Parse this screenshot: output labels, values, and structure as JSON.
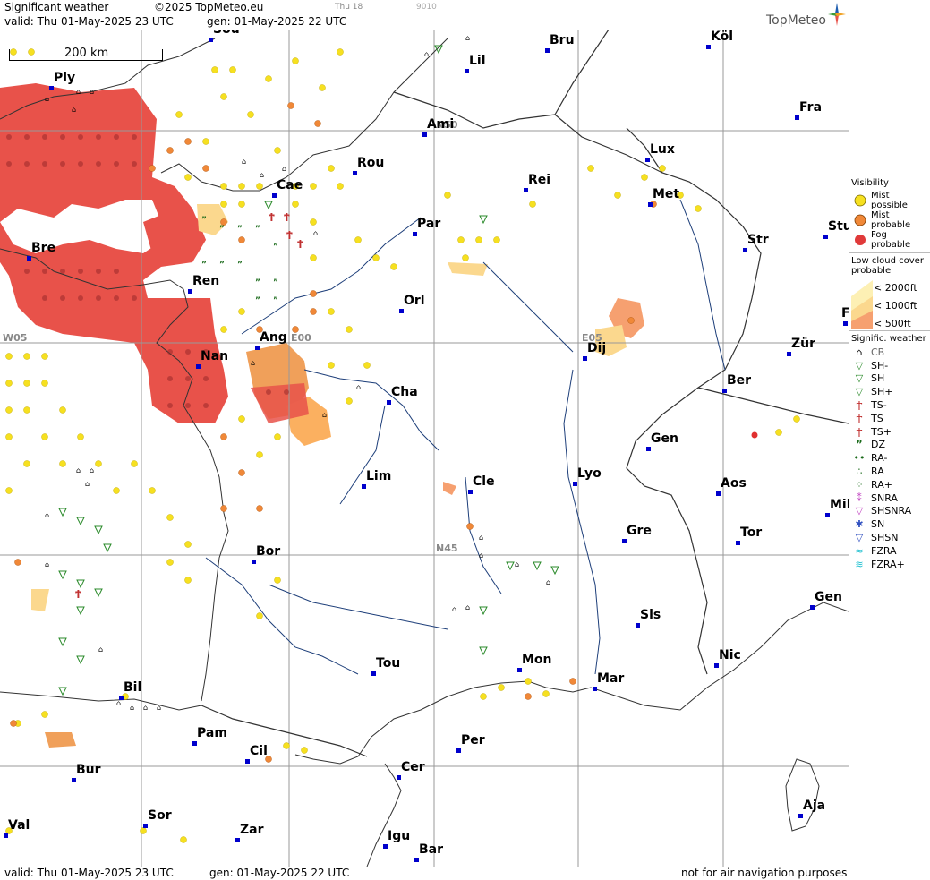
{
  "header": {
    "title": "Significant weather",
    "copyright": "©2025 TopMeteo.eu",
    "run_label": "Thu 18",
    "code": "9010",
    "valid": "valid:  Thu   01-May-2025  23 UTC",
    "gen": "gen:  01-May-2025  22 UTC",
    "brand": "TopMeteo"
  },
  "footer": {
    "valid": "valid:  Thu   01-May-2025   23  UTC",
    "gen": "gen:  01-May-2025  22 UTC",
    "disclaimer": "not for air navigation purposes"
  },
  "scale": {
    "label": "200 km"
  },
  "grid_labels": [
    "N50",
    "N45",
    "W05",
    "E00",
    "E05"
  ],
  "cities": [
    "Sou",
    "Bru",
    "Köl",
    "Lil",
    "Ply",
    "Ami",
    "Fra",
    "Lux",
    "Rou",
    "Cae",
    "Rei",
    "Met",
    "Par",
    "Stu",
    "Str",
    "Bre",
    "Ren",
    "Orl",
    "Ang",
    "Dij",
    "Zür",
    "Nan",
    "Cha",
    "Ber",
    "Gen",
    "Lim",
    "Cle",
    "Lyo",
    "Aos",
    "Mil",
    "Gre",
    "Tor",
    "Bor",
    "Gen",
    "Sis",
    "Tou",
    "Mon",
    "Nic",
    "Mar",
    "Bil",
    "Pam",
    "Cil",
    "Per",
    "Bur",
    "Cer",
    "Sor",
    "Zar",
    "Aja",
    "Val",
    "Igu",
    "Bar",
    "F"
  ],
  "legend": {
    "visibility_title": "Visibility",
    "visibility": [
      "Mist possible",
      "Mist probable",
      "Fog probable"
    ],
    "cloud_title": "Low cloud cover probable",
    "cloud": [
      "< 2000ft",
      "< 1000ft",
      "<  500ft"
    ],
    "sigwx_title": "Signific. weather",
    "sigwx": [
      "CB",
      "SH-",
      "SH",
      "SH+",
      "TS-",
      "TS",
      "TS+",
      "DZ",
      "RA-",
      "RA",
      "RA+",
      "SNRA",
      "SHSNRA",
      "SN",
      "SHSN",
      "FZRA",
      "FZRA+"
    ]
  },
  "colors": {
    "fog": "#e8524a",
    "mist_probable": "#f08838",
    "mist_possible": "#f6e020",
    "cloud_2000": "#fdf0b4",
    "cloud_1000": "#fbd88e",
    "cloud_500": "#f6a070",
    "city_dot": "#0000cc",
    "river": "#1e3f7a",
    "border": "#333333"
  }
}
